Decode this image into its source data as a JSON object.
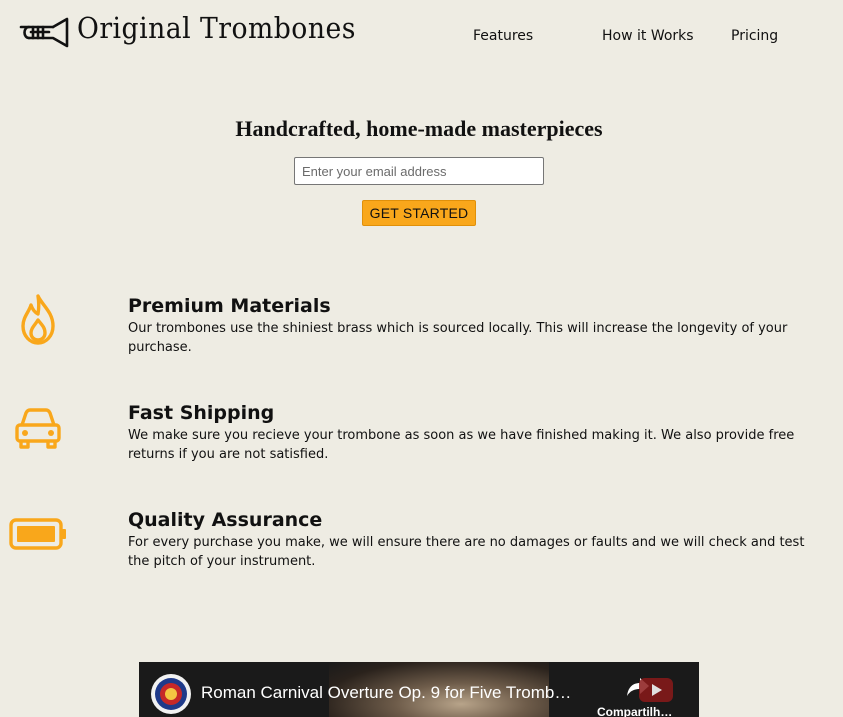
{
  "header": {
    "brand": "Original Trombones",
    "logo_icon": "trombone-icon",
    "nav": [
      "Features",
      "How it Works",
      "Pricing"
    ]
  },
  "hero": {
    "title": "Handcrafted, home-made masterpieces",
    "email_placeholder": "Enter your email address",
    "cta_label": "GET STARTED"
  },
  "features": [
    {
      "icon": "fire-icon",
      "title": "Premium Materials",
      "description": "Our trombones use the shiniest brass which is sourced locally. This will increase the longevity of your purchase."
    },
    {
      "icon": "car-icon",
      "title": "Fast Shipping",
      "description": "We make sure you recieve your trombone as soon as we have finished making it. We also provide free returns if you are not satisfied."
    },
    {
      "icon": "battery-full-icon",
      "title": "Quality Assurance",
      "description": "For every purchase you make, we will ensure there are no damages or faults and we will check and test the pitch of your instrument."
    }
  ],
  "video": {
    "title": "Roman Carnival Overture Op. 9 for Five Tromb…",
    "share_label": "Compartilh…"
  },
  "colors": {
    "background": "#eeece3",
    "accent": "#f9a71b",
    "icon": "#f9a71b"
  }
}
